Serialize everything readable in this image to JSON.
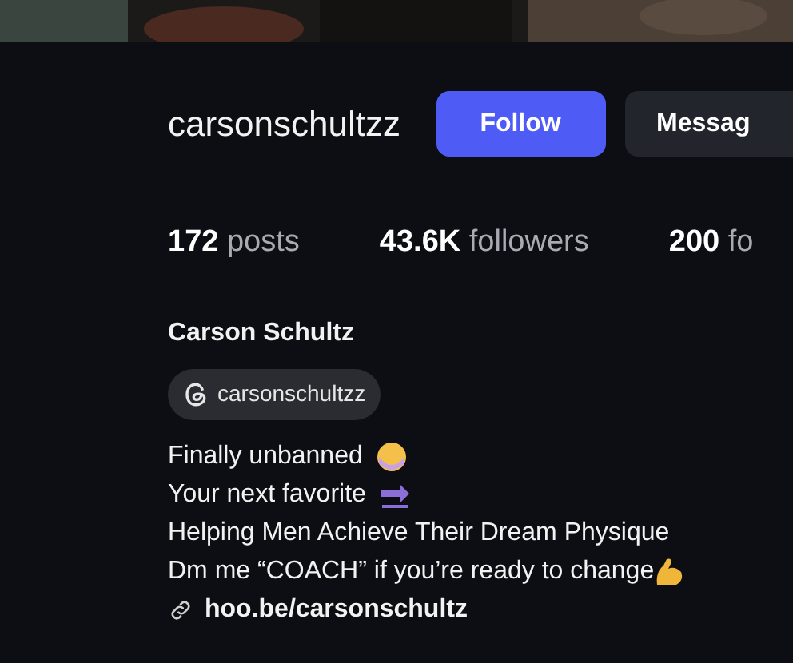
{
  "profile": {
    "username": "carsonschultzz",
    "buttons": [
      {
        "label": "Follow",
        "kind": "primary"
      },
      {
        "label": "Messag",
        "kind": "secondary"
      }
    ],
    "stats": [
      {
        "count": "172",
        "label": "posts"
      },
      {
        "count": "43.6K",
        "label": "followers"
      },
      {
        "count": "200",
        "label": "fo"
      }
    ],
    "name": "Carson Schultz",
    "threads_handle": "carsonschultzz",
    "bio": [
      {
        "text": "Finally unbanned",
        "kind": "face"
      },
      {
        "text": "Your next favorite",
        "kind": "arrow"
      },
      {
        "text": "Helping Men Achieve Their Dream Physique",
        "kind": "plain"
      },
      {
        "text": "Dm me “COACH” if you’re ready to change",
        "kind": "arm"
      }
    ],
    "link": "hoo.be/carsonschultz"
  }
}
